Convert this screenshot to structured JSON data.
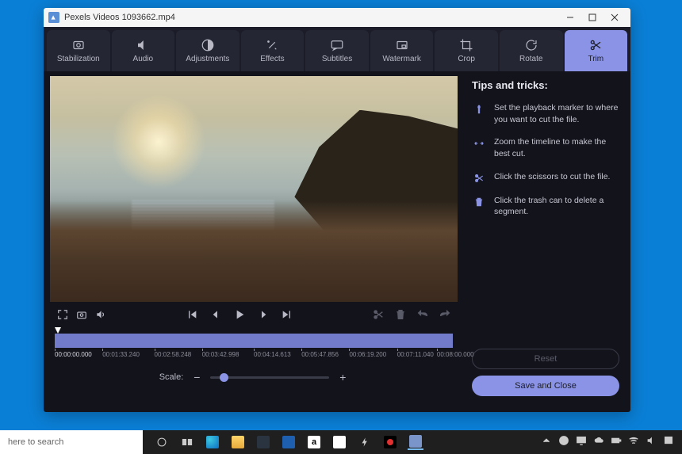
{
  "window": {
    "title": "Pexels Videos 1093662.mp4"
  },
  "toolbar": {
    "items": [
      {
        "label": "Stabilization"
      },
      {
        "label": "Audio"
      },
      {
        "label": "Adjustments"
      },
      {
        "label": "Effects"
      },
      {
        "label": "Subtitles"
      },
      {
        "label": "Watermark"
      },
      {
        "label": "Crop"
      },
      {
        "label": "Rotate"
      },
      {
        "label": "Trim"
      }
    ],
    "active_index": 8
  },
  "timeline": {
    "current": "00:00:00.000",
    "ticks": [
      "00:00:00.000",
      "00:01:33.240",
      "00:02:58.248",
      "00:03:42.998",
      "00:04:14.613",
      "00:05:47.856",
      "00:06:19.200",
      "00:07:11.040",
      "00:08:00.000"
    ]
  },
  "scale": {
    "label": "Scale:",
    "minus": "−",
    "plus": "+"
  },
  "tips": {
    "title": "Tips and tricks:",
    "items": [
      "Set the playback marker to where you want to cut the file.",
      "Zoom the timeline to make the best cut.",
      "Click the scissors to cut the file.",
      "Click the trash can to delete a segment."
    ]
  },
  "buttons": {
    "reset": "Reset",
    "save": "Save and Close"
  },
  "taskbar": {
    "search_placeholder": "here to search"
  }
}
